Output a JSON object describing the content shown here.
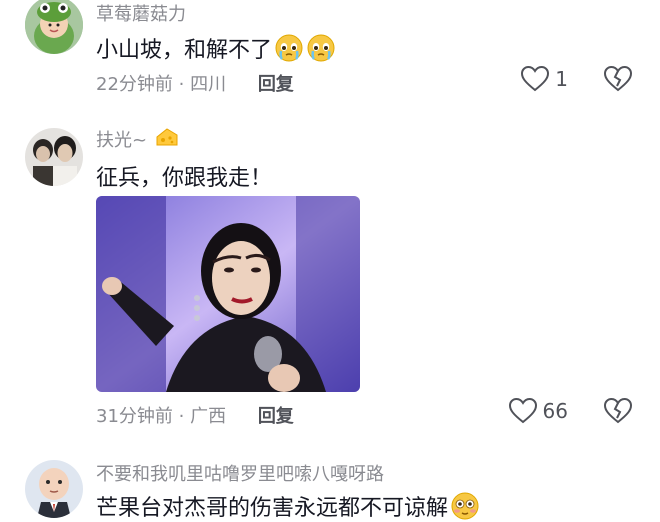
{
  "comments": [
    {
      "username": "草莓蘑菇力",
      "text": "小山坡，和解不了",
      "emojis": [
        "crying-face",
        "crying-face"
      ],
      "time": "22分钟前",
      "location": "四川",
      "reply_label": "回复",
      "likes": "1"
    },
    {
      "username": "扶光~",
      "text": "征兵，你跟我走！",
      "time": "31分钟前",
      "location": "广西",
      "reply_label": "回复",
      "likes": "66"
    },
    {
      "username": "不要和我叽里咕噜罗里吧嗦八嘎呀路",
      "text": "芒果台对杰哥的伤害永远都不可谅解",
      "emojis": [
        "flushed-face"
      ]
    }
  ],
  "separator": " · ",
  "colors": {
    "username": "#8a8b91",
    "text": "#161823",
    "meta": "#8a8b91"
  }
}
